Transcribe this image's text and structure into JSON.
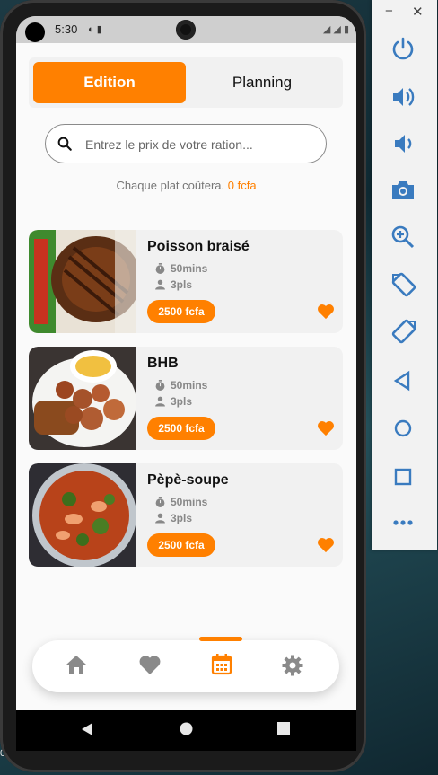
{
  "status_bar": {
    "time": "5:30"
  },
  "tabs": {
    "edition": "Edition",
    "planning": "Planning"
  },
  "search": {
    "placeholder": "Entrez le prix de votre ration..."
  },
  "price_info": {
    "text": "Chaque plat coûtera.",
    "amount": "0 fcfa"
  },
  "dishes": [
    {
      "name": "Poisson braisé",
      "time": "50mins",
      "servings": "3pls",
      "price": "2500 fcfa"
    },
    {
      "name": "BHB",
      "time": "50mins",
      "servings": "3pls",
      "price": "2500 fcfa"
    },
    {
      "name": "Pèpè-soupe",
      "time": "50mins",
      "servings": "3pls",
      "price": "2500 fcfa"
    }
  ],
  "bottom_nav": {
    "items": [
      "home-icon",
      "heart-icon",
      "calendar-icon",
      "gear-icon"
    ],
    "active": "calendar-icon"
  },
  "emulator_panel": {
    "buttons": [
      "power-icon",
      "volume-up-icon",
      "volume-down-icon",
      "camera-icon",
      "zoom-in-icon",
      "rotate-left-icon",
      "rotate-right-icon",
      "back-icon",
      "home-circle-icon",
      "overview-icon",
      "more-icon"
    ]
  },
  "colors": {
    "accent": "#ff8000",
    "background": "#fafafa",
    "card": "#f1f1f1"
  }
}
